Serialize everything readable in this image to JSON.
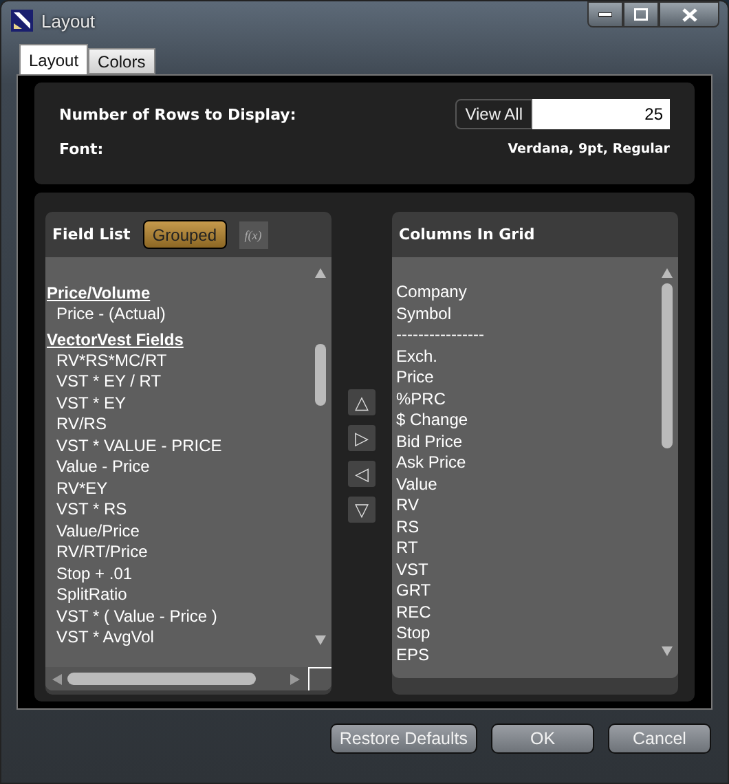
{
  "window": {
    "title": "Layout"
  },
  "tabs": [
    {
      "label": "Layout",
      "selected": true
    },
    {
      "label": "Colors",
      "selected": false
    }
  ],
  "settings": {
    "rows_label": "Number of Rows to Display:",
    "view_all_button": "View All",
    "rows_value": "25",
    "font_label": "Font:",
    "font_value": "Verdana, 9pt, Regular"
  },
  "field_list": {
    "title": "Field List",
    "grouped_button": {
      "label": "Grouped",
      "selected": true
    },
    "formula_button": {
      "label": "f(x)",
      "disabled": true
    },
    "groups": [
      {
        "label": "Price/Volume",
        "children": [
          {
            "label": "Price - (Actual)"
          }
        ]
      },
      {
        "label": "VectorVest Fields",
        "children": [
          {
            "label": "RV*RS*MC/RT"
          },
          {
            "label": "VST * EY / RT"
          },
          {
            "label": "VST * EY"
          },
          {
            "label": "RV/RS"
          },
          {
            "label": "VST * VALUE - PRICE"
          },
          {
            "label": "Value - Price"
          },
          {
            "label": "RV*EY"
          },
          {
            "label": "VST * RS"
          },
          {
            "label": "Value/Price"
          },
          {
            "label": "RV/RT/Price"
          },
          {
            "label": "Stop + .01"
          },
          {
            "label": "SplitRatio"
          },
          {
            "label": "VST  *  ( Value - Price )"
          },
          {
            "label": "VST * AvgVol"
          }
        ]
      }
    ]
  },
  "move_buttons": [
    "△",
    "▷",
    "◁",
    "▽"
  ],
  "columns_in_grid": {
    "title": "Columns In Grid",
    "items": [
      "Company",
      "Symbol",
      "----------------",
      "Exch.",
      "Price",
      "%PRC",
      "$ Change",
      "Bid Price",
      "Ask Price",
      "Value",
      "RV",
      "RS",
      "RT",
      "VST",
      "GRT",
      "REC",
      "Stop",
      "EPS"
    ]
  },
  "buttons": [
    "Restore Defaults",
    "OK",
    "Cancel"
  ]
}
